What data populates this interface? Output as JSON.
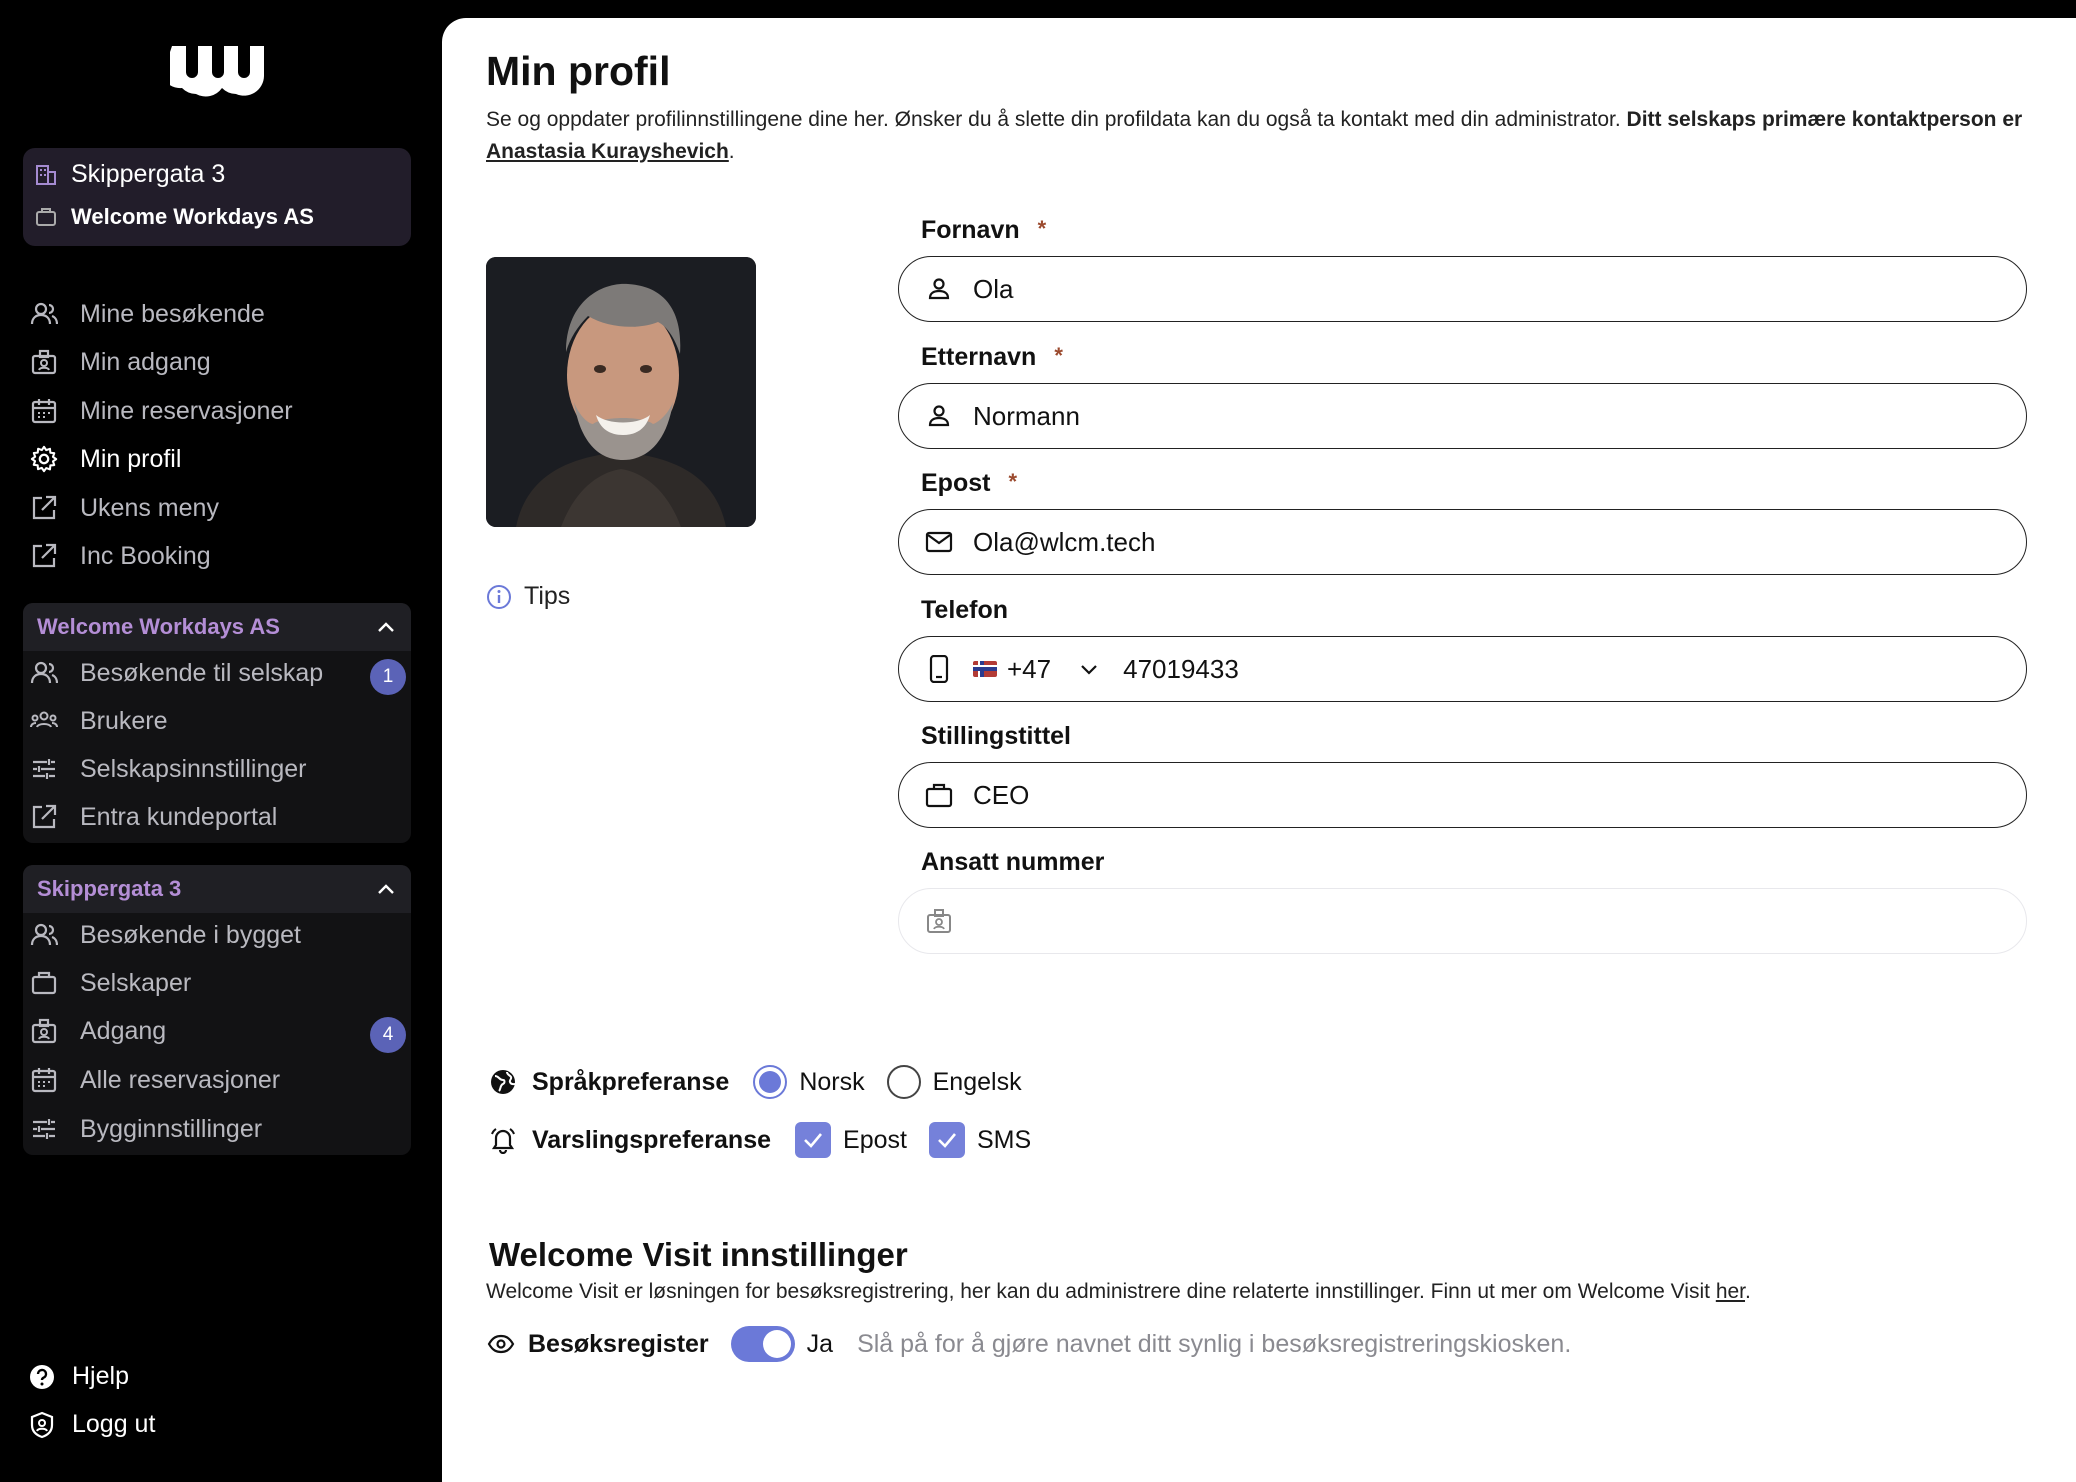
{
  "sidebar": {
    "location": {
      "building": "Skippergata 3",
      "company": "Welcome Workdays AS"
    },
    "nav": [
      {
        "label": "Mine besøkende",
        "icon": "users-icon"
      },
      {
        "label": "Min adgang",
        "icon": "badge-icon"
      },
      {
        "label": "Mine reservasjoner",
        "icon": "calendar-icon"
      },
      {
        "label": "Min profil",
        "icon": "gear-icon",
        "active": true
      },
      {
        "label": "Ukens meny",
        "icon": "external-link-icon"
      },
      {
        "label": "Inc Booking",
        "icon": "external-link-icon"
      }
    ],
    "company_group": {
      "title": "Welcome Workdays AS",
      "items": [
        {
          "label": "Besøkende til selskap",
          "badge": "1"
        },
        {
          "label": "Brukere"
        },
        {
          "label": "Selskapsinnstillinger"
        },
        {
          "label": "Entra kundeportal"
        }
      ]
    },
    "building_group": {
      "title": "Skippergata 3",
      "items": [
        {
          "label": "Besøkende i bygget"
        },
        {
          "label": "Selskaper"
        },
        {
          "label": "Adgang",
          "badge": "4"
        },
        {
          "label": "Alle reservasjoner"
        },
        {
          "label": "Bygginnstillinger"
        }
      ]
    },
    "bottom": {
      "help": "Hjelp",
      "logout": "Logg ut"
    }
  },
  "main": {
    "title": "Min profil",
    "intro_text": "Se og oppdater profilinnstillingene dine her. Ønsker du å slette din profildata kan du også ta kontakt med din administrator.",
    "intro_bold": "Ditt selskaps primære kontaktperson er",
    "contact_name": "Anastasia Kurayshevich",
    "tips": "Tips",
    "fields": {
      "first_name": {
        "label": "Fornavn",
        "value": "Ola",
        "required": "*"
      },
      "last_name": {
        "label": "Etternavn",
        "value": "Normann",
        "required": "*"
      },
      "email": {
        "label": "Epost",
        "value": "Ola@wlcm.tech",
        "required": "*"
      },
      "phone": {
        "label": "Telefon",
        "prefix": "+47",
        "value": "47019433"
      },
      "job_title": {
        "label": "Stillingstittel",
        "value": "CEO"
      },
      "employee_number": {
        "label": "Ansatt nummer",
        "value": ""
      }
    },
    "language_pref": {
      "label": "Språkpreferanse",
      "options": [
        "Norsk",
        "Engelsk"
      ],
      "selected": "Norsk"
    },
    "notification_pref": {
      "label": "Varslingspreferanse",
      "options": [
        "Epost",
        "SMS"
      ]
    },
    "visit": {
      "title": "Welcome Visit innstillinger",
      "desc": "Welcome Visit er løsningen for besøksregistrering, her kan du administrere dine relaterte innstillinger. Finn ut mer om Welcome Visit",
      "link": "her",
      "register_label": "Besøksregister",
      "toggle_value": "Ja",
      "hint": "Slå på for å gjøre navnet ditt synlig i besøksregistreringskiosken."
    }
  },
  "colors": {
    "accent": "#6b79d8",
    "group_title": "#b48ed6",
    "badge": "#5b63b7"
  }
}
